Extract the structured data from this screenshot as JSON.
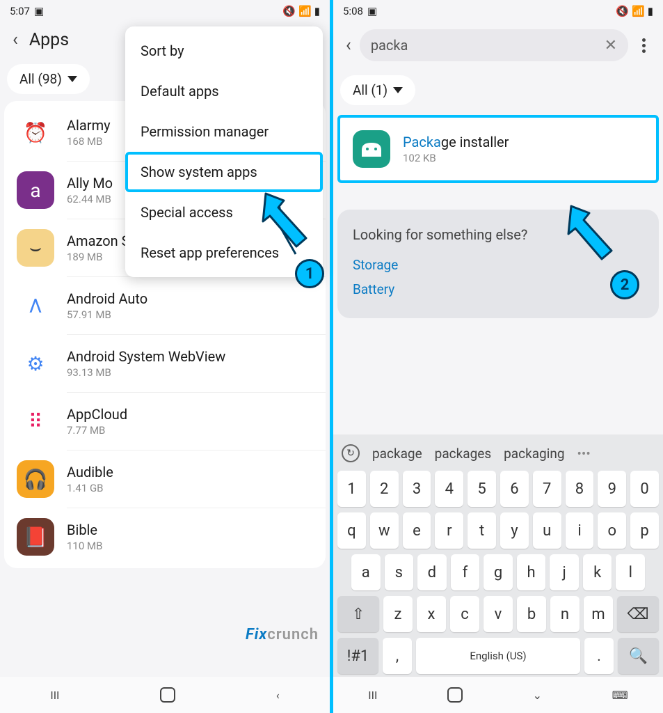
{
  "panel1": {
    "status": {
      "time": "5:07",
      "cam": true
    },
    "header_title": "Apps",
    "filter_label": "All (98)",
    "popup": {
      "items": [
        "Sort by",
        "Default apps",
        "Permission manager",
        "Show system apps",
        "Special access",
        "Reset app preferences"
      ]
    },
    "apps": [
      {
        "name": "Alarmy",
        "size": "168 MB",
        "bg": "#fff",
        "emoji": "⏰",
        "fg": "#e53935"
      },
      {
        "name": "Ally Mo",
        "size": "62.44 MB",
        "bg": "#7a2f8a",
        "emoji": "a",
        "fg": "#fff"
      },
      {
        "name": "Amazon Shopping",
        "size": "189 MB",
        "bg": "#f5d48a",
        "emoji": "⌣",
        "fg": "#333"
      },
      {
        "name": "Android Auto",
        "size": "57.91 MB",
        "bg": "#fff",
        "emoji": "Λ",
        "fg": "#4285f4"
      },
      {
        "name": "Android System WebView",
        "size": "93.13 MB",
        "bg": "#fff",
        "emoji": "⚙",
        "fg": "#4285f4"
      },
      {
        "name": "AppCloud",
        "size": "7.77 MB",
        "bg": "#fff",
        "emoji": "⠿",
        "fg": "#e91e63"
      },
      {
        "name": "Audible",
        "size": "1.41 GB",
        "bg": "#f6a623",
        "emoji": "🎧",
        "fg": "#fff"
      },
      {
        "name": "Bible",
        "size": "110 MB",
        "bg": "#6b3a2e",
        "emoji": "📕",
        "fg": "#fff"
      }
    ],
    "watermark": {
      "a": "Fix",
      "b": "crunch"
    },
    "bubble": "1"
  },
  "panel2": {
    "status": {
      "time": "5:08"
    },
    "search_value": "packa",
    "filter_label": "All (1)",
    "result": {
      "match": "Packa",
      "rest": "ge installer",
      "size": "102 KB"
    },
    "else_q": "Looking for something else?",
    "else_links": [
      "Storage",
      "Battery"
    ],
    "suggestions": [
      "package",
      "packages",
      "packaging"
    ],
    "kb_rows": {
      "r1": [
        "1",
        "2",
        "3",
        "4",
        "5",
        "6",
        "7",
        "8",
        "9",
        "0"
      ],
      "r2": [
        "q",
        "w",
        "e",
        "r",
        "t",
        "y",
        "u",
        "i",
        "o",
        "p"
      ],
      "r3": [
        "a",
        "s",
        "d",
        "f",
        "g",
        "h",
        "j",
        "k",
        "l"
      ],
      "r4": [
        "z",
        "x",
        "c",
        "v",
        "b",
        "n",
        "m"
      ],
      "space_label": "English (US)",
      "sym_label": "!#1"
    },
    "bubble": "2"
  }
}
